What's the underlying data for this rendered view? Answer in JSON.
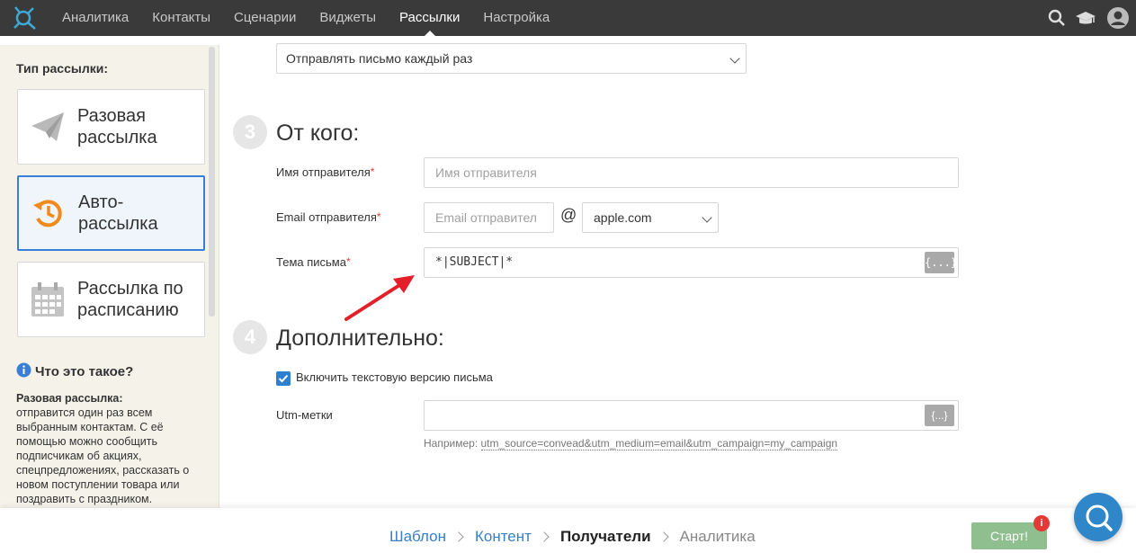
{
  "nav": {
    "items": [
      {
        "label": "Аналитика",
        "active": false
      },
      {
        "label": "Контакты",
        "active": false
      },
      {
        "label": "Сценарии",
        "active": false
      },
      {
        "label": "Виджеты",
        "active": false
      },
      {
        "label": "Рассылки",
        "active": true
      },
      {
        "label": "Настройка",
        "active": false
      }
    ],
    "icons": [
      "logo-icon",
      "search-icon",
      "graduation-cap-icon",
      "user-avatar-icon"
    ]
  },
  "sidebar": {
    "title": "Тип рассылки:",
    "types": [
      {
        "label": "Разовая рассылка",
        "icon": "paper-plane-icon",
        "active": false
      },
      {
        "label": "Авто-рассылка",
        "icon": "auto-clock-icon",
        "active": true
      },
      {
        "label": "Рассылка по расписанию",
        "icon": "calendar-icon",
        "active": false
      }
    ],
    "help_title": "Что это такое?",
    "help_heading": "Разовая рассылка:",
    "help_text": "отправится один раз всем выбранным контактам. С её помощью можно сообщить подписчикам об акциях, спецпредложениях, рассказать о новом поступлении товара или поздравить с праздником."
  },
  "main": {
    "send_mode_value": "Отправлять письмо каждый раз",
    "section3": {
      "number": "3",
      "title": "От кого:"
    },
    "sender_name": {
      "label": "Имя отправителя",
      "required": "*",
      "placeholder": "Имя отправителя"
    },
    "sender_email": {
      "label": "Email отправителя",
      "required": "*",
      "placeholder": "Email отправител",
      "at": "@",
      "domain": "apple.com"
    },
    "subject": {
      "label": "Тема письма",
      "required": "*",
      "value": "*|SUBJECT|*",
      "tag_button": "{...}"
    },
    "section4": {
      "number": "4",
      "title": "Дополнительно:"
    },
    "text_version": {
      "label": "Включить текстовую версию письма",
      "checked": true
    },
    "utm": {
      "label": "Utm-метки",
      "value": "",
      "tag_button": "{...}",
      "hint_prefix": "Например:",
      "hint_example": "utm_source=convead&utm_medium=email&utm_campaign=my_campaign"
    }
  },
  "footer": {
    "steps": [
      {
        "label": "Шаблон",
        "state": "done"
      },
      {
        "label": "Контент",
        "state": "done"
      },
      {
        "label": "Получатели",
        "state": "current"
      },
      {
        "label": "Аналитика",
        "state": "disabled"
      }
    ],
    "start_label": "Старт!",
    "notif_badge": "i"
  },
  "colors": {
    "accent": "#3a7fd5",
    "topbar": "#3a3a3a",
    "sidebar_bg": "#f5f2ea",
    "start_button": "#8fbf8f",
    "required": "#e53935",
    "arrow": "#e3202a"
  }
}
